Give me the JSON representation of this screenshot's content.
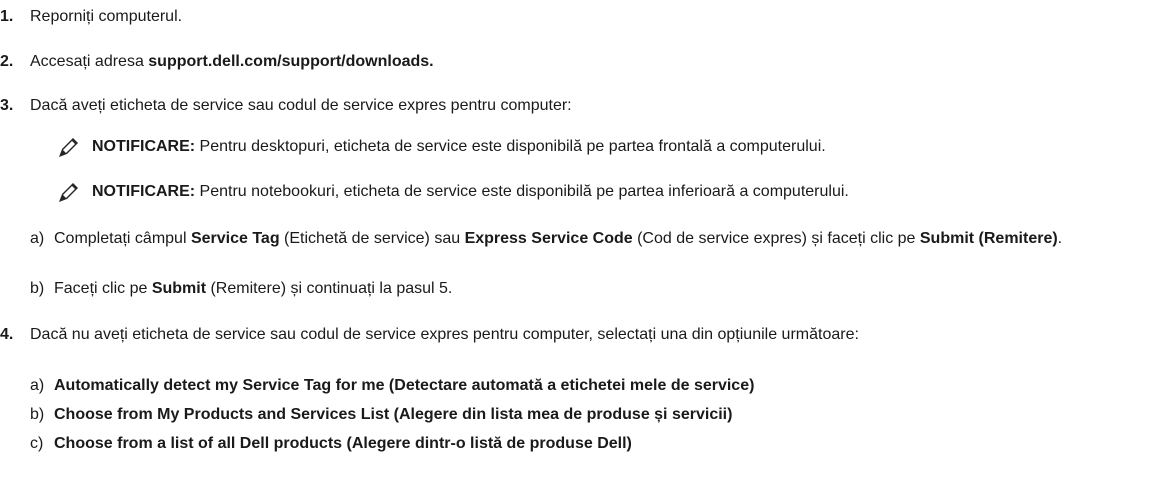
{
  "steps": [
    {
      "num": "1.",
      "text": "Reporniți computerul."
    },
    {
      "num": "2.",
      "pre": "Accesați adresa ",
      "link": "support.dell.com/support/downloads."
    },
    {
      "num": "3.",
      "text": "Dacă aveți eticheta de service sau codul de service expres pentru computer:"
    },
    {
      "num": "4.",
      "text": "Dacă nu aveți eticheta de service sau codul de service expres pentru computer, selectați una din opțiunile următoare:"
    }
  ],
  "notes": [
    {
      "label": "NOTIFICARE:",
      "text": " Pentru desktopuri, eticheta de service este disponibilă pe partea frontală a computerului."
    },
    {
      "label": "NOTIFICARE:",
      "text": " Pentru notebookuri, eticheta de service este disponibilă pe partea inferioară a computerului."
    }
  ],
  "step3_sub": [
    {
      "label": "a)",
      "t1": "Completați câmpul ",
      "b1": "Service Tag",
      "t2": " (Etichetă de service) sau ",
      "b2": "Express Service Code",
      "t3": " (Cod de service expres) și faceți clic pe ",
      "b3": "Submit (Remitere)",
      "t4": "."
    },
    {
      "label": "b)",
      "t1": "Faceți clic pe ",
      "b1": "Submit",
      "t2": " (Remitere) și continuați la pasul 5."
    }
  ],
  "step4_sub": [
    {
      "label": "a)",
      "text": "Automatically detect my Service Tag for me (Detectare automată a etichetei mele de service)"
    },
    {
      "label": "b)",
      "text": "Choose from My Products and Services List (Alegere din lista mea de produse și servicii)"
    },
    {
      "label": "c)",
      "text": "Choose from a list of all Dell products (Alegere dintr-o listă de produse Dell)"
    }
  ]
}
